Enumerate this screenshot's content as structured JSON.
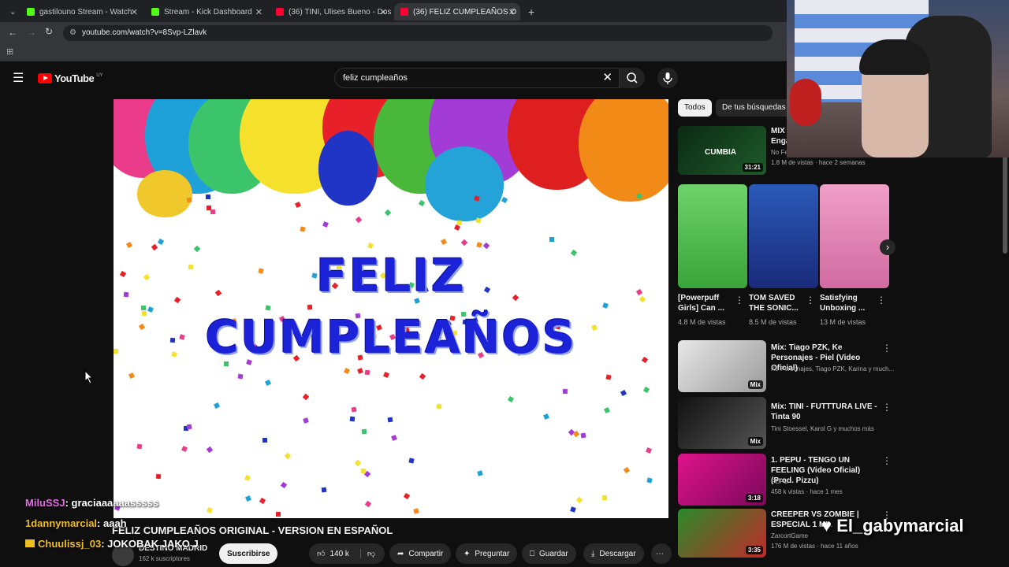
{
  "browser": {
    "tabs": [
      {
        "label": "gastilouno Stream - Watch",
        "fav": "#53fc18"
      },
      {
        "label": "Stream - Kick Dashboard",
        "fav": "#53fc18"
      },
      {
        "label": "(36) TINI, Ulises Bueno - Dos A",
        "fav": "#ff0033"
      },
      {
        "label": "(36) FELIZ CUMPLEAÑOS O",
        "fav": "#ff0033"
      }
    ],
    "url": "youtube.com/watch?v=8Svp-LZlavk"
  },
  "youtube": {
    "logo": "YouTube",
    "region": "UY",
    "search_value": "feliz cumpleaños"
  },
  "video": {
    "overlay_line1": "FELIZ",
    "overlay_line2": "CUMPLEAÑOS",
    "title": "FELIZ CUMPLEAÑOS ORIGINAL - VERSION EN ESPAÑOL",
    "channel": "DESTINO MADRID",
    "subscribers": "162 k suscriptores",
    "subscribe": "Suscribirse",
    "likes": "140 k",
    "share": "Compartir",
    "ask": "Preguntar",
    "save": "Guardar",
    "download": "Descargar"
  },
  "chat": [
    {
      "user": "MiluSSJ",
      "msg": ": graciaaaaaasssss",
      "color": "#e070e0"
    },
    {
      "user": "1dannymarcial",
      "msg": ": aaah",
      "color": "#f0c020"
    },
    {
      "user": "Chuulissj_03",
      "msg": ": JOKOBAK JAKO J",
      "color": "#f0c020"
    }
  ],
  "sidebar": {
    "chips": [
      "Todos",
      "De tus búsquedas"
    ],
    "top": {
      "title_line1": "MIX",
      "title_line2": "Enga",
      "meta1": "No Fe",
      "meta2": "1.8 M de vistas · hace 2 semanas",
      "duration": "31:21"
    },
    "shorts": [
      {
        "title": "[Powerpuff Girls] Can ...",
        "views": "4.8 M de vistas"
      },
      {
        "title": "TOM SAVED THE SONIC...",
        "views": "8.5 M de vistas"
      },
      {
        "title": "Satisfying Unboxing ...",
        "views": "13 M de vistas"
      }
    ],
    "items": [
      {
        "title": "Mix: Tiago PZK, Ke Personajes - Piel (Video Oficial)",
        "meta": "Ke Personajes, Tiago PZK, Karina y much...",
        "badge": "Mix",
        "views": ""
      },
      {
        "title": "Mix: TINI - FUTTTURA LIVE - Tinta 90",
        "meta": "Tini Stoessel, Karol G y muchos más",
        "badge": "Mix",
        "views": ""
      },
      {
        "title": "1. PEPU - TENGO UN FEELING (Video Oficial) (Prod. Pizzu)",
        "meta": "PEPU",
        "badge": "3:18",
        "views": "458 k vistas · hace 1 mes"
      },
      {
        "title": "CREEPER VS ZOMBIE | ESPECIAL 1 MIL",
        "meta": "ZarcortGame",
        "badge": "3:35",
        "views": "176 M de vistas · hace 11 años"
      }
    ]
  },
  "streamer": "El_gabymarcial"
}
